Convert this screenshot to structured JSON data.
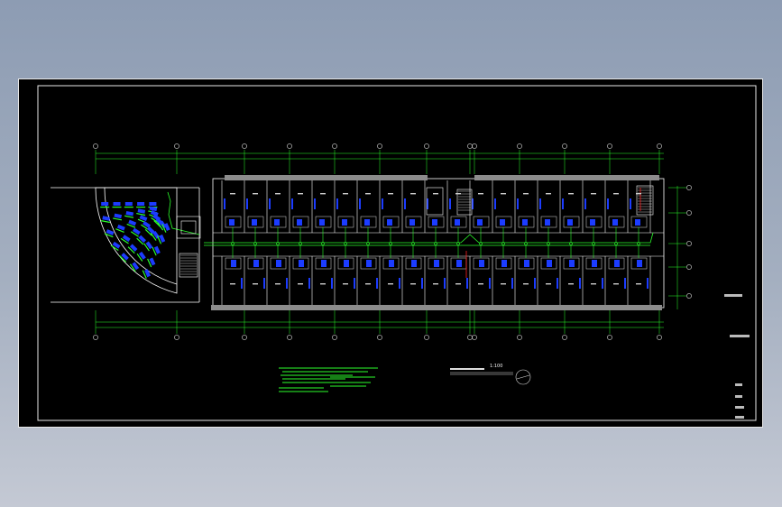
{
  "drawing": {
    "scale_label": "1:100",
    "title_label": "",
    "right_labels": [
      "",
      "",
      "",
      ""
    ],
    "colors": {
      "background": "#000000",
      "frame": "#e8e8e8",
      "wall": "#ffffff",
      "fill_gray": "#8c8c8c",
      "wiring": "#2bff2b",
      "fixture": "#1c3cff",
      "accent_red": "#ff2020",
      "axis_dim": "#2bff2b"
    }
  }
}
